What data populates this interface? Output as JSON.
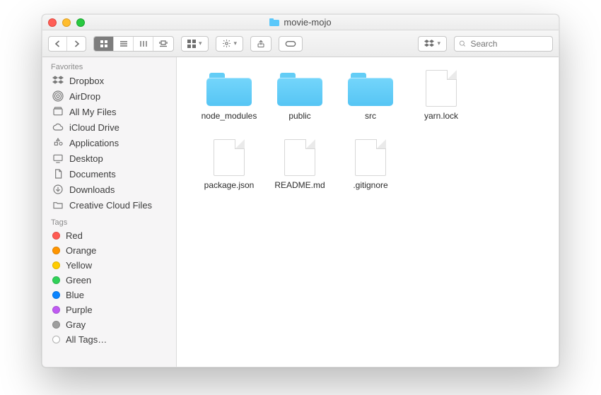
{
  "window": {
    "title": "movie-mojo"
  },
  "toolbar": {
    "search_placeholder": "Search"
  },
  "sidebar": {
    "sections": {
      "favorites_label": "Favorites",
      "tags_label": "Tags"
    },
    "favorites": [
      {
        "label": "Dropbox",
        "icon": "dropbox"
      },
      {
        "label": "AirDrop",
        "icon": "airdrop"
      },
      {
        "label": "All My Files",
        "icon": "allfiles"
      },
      {
        "label": "iCloud Drive",
        "icon": "icloud"
      },
      {
        "label": "Applications",
        "icon": "apps"
      },
      {
        "label": "Desktop",
        "icon": "desktop"
      },
      {
        "label": "Documents",
        "icon": "docs"
      },
      {
        "label": "Downloads",
        "icon": "downloads"
      },
      {
        "label": "Creative Cloud Files",
        "icon": "folder"
      }
    ],
    "tags": [
      {
        "label": "Red",
        "color": "#ff5a52"
      },
      {
        "label": "Orange",
        "color": "#ff9500"
      },
      {
        "label": "Yellow",
        "color": "#ffcc00"
      },
      {
        "label": "Green",
        "color": "#30d158"
      },
      {
        "label": "Blue",
        "color": "#0a84ff"
      },
      {
        "label": "Purple",
        "color": "#bf5af2"
      },
      {
        "label": "Gray",
        "color": "#9e9e9e"
      },
      {
        "label": "All Tags…",
        "color": "outline"
      }
    ]
  },
  "files": [
    {
      "name": "node_modules",
      "type": "folder"
    },
    {
      "name": "public",
      "type": "folder"
    },
    {
      "name": "src",
      "type": "folder"
    },
    {
      "name": "yarn.lock",
      "type": "file"
    },
    {
      "name": "package.json",
      "type": "file"
    },
    {
      "name": "README.md",
      "type": "file"
    },
    {
      "name": ".gitignore",
      "type": "file"
    }
  ]
}
